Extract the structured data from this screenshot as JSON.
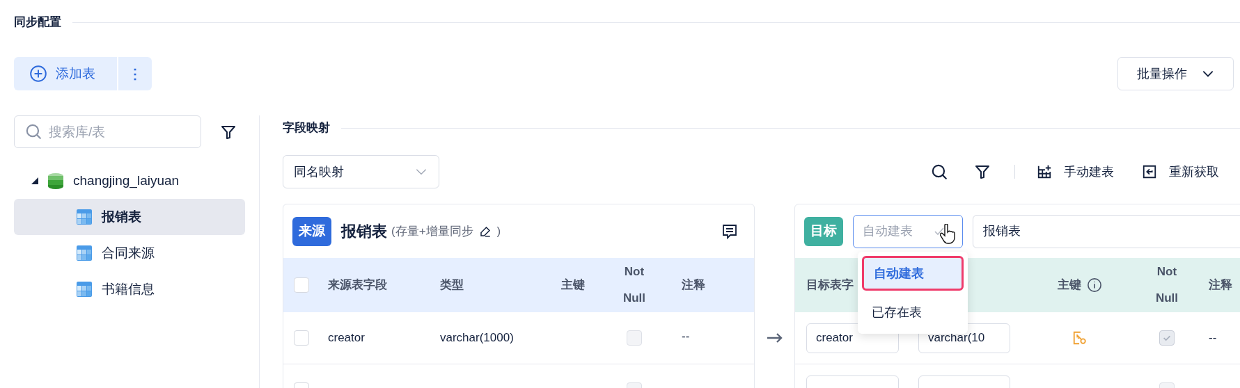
{
  "section_title": "同步配置",
  "add_button": {
    "label": "添加表"
  },
  "more_button": {
    "label": "⋮"
  },
  "batch_button": {
    "label": "批量操作"
  },
  "search": {
    "placeholder": "搜索库/表"
  },
  "tree": [
    {
      "label": "changjing_laiyuan",
      "expanded": true,
      "children": [
        {
          "label": "报销表",
          "selected": true
        },
        {
          "label": "合同来源",
          "selected": false
        },
        {
          "label": "书籍信息",
          "selected": false
        }
      ]
    }
  ],
  "mapping": {
    "title": "字段映射",
    "mode": "同名映射",
    "tools": [
      {
        "kind": "create",
        "label": "手动建表"
      },
      {
        "kind": "refresh",
        "label": "重新获取"
      }
    ]
  },
  "source": {
    "badge": "来源",
    "table": "报销表",
    "sync_note": "(存量+增量同步",
    "sync_note_end": ")",
    "select_all_checked": false,
    "columns": [
      "来源表字段",
      "类型",
      "主键",
      "Not Null",
      "注释"
    ],
    "rows": [
      {
        "checked": false,
        "field": "creator",
        "type": "varchar(1000)",
        "not_null": false,
        "comment": "--"
      },
      {
        "checked": false,
        "not_null": false
      }
    ]
  },
  "target": {
    "badge": "目标",
    "mode_placeholder": "自动建表",
    "table": "报销表",
    "columns": [
      "目标表字",
      "主键",
      "Not Null",
      "注释"
    ],
    "rows": [
      {
        "field": "creator",
        "type": "varchar(10",
        "primary_key": true,
        "not_null": true,
        "comment": "--"
      },
      {
        "kind": "partial",
        "not_null": false
      }
    ]
  },
  "mode_menu": [
    {
      "label": "自动建表",
      "selected": true
    },
    {
      "label": "已存在表",
      "selected": false
    }
  ]
}
